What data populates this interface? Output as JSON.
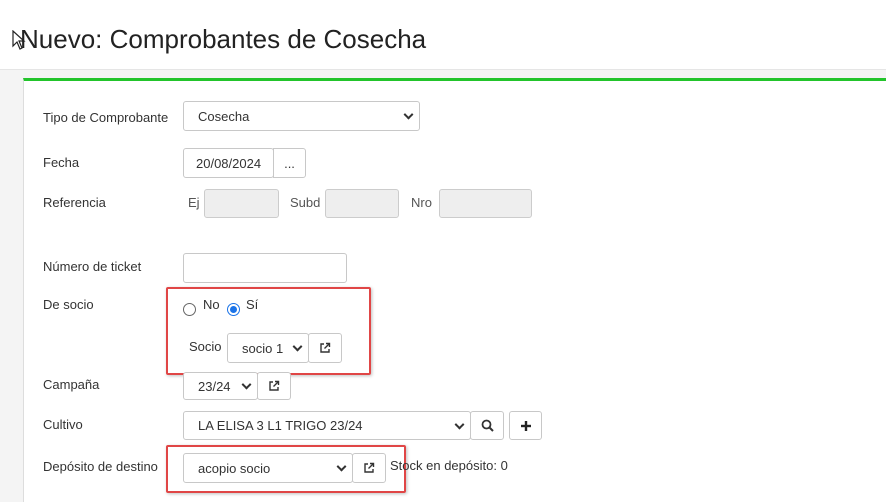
{
  "page": {
    "title": "Nuevo: Comprobantes de Cosecha"
  },
  "form": {
    "tipo_comprobante": {
      "label": "Tipo de Comprobante",
      "value": "Cosecha"
    },
    "fecha": {
      "label": "Fecha",
      "value": "20/08/2024",
      "picker_label": "..."
    },
    "referencia": {
      "label": "Referencia",
      "ej_label": "Ej",
      "subd_label": "Subd",
      "nro_label": "Nro"
    },
    "numero_ticket": {
      "label": "Número de ticket",
      "value": ""
    },
    "de_socio": {
      "label": "De socio",
      "option_no": "No",
      "option_si": "Sí",
      "selected": "Sí"
    },
    "socio": {
      "label": "Socio",
      "value": "socio 1"
    },
    "campana": {
      "label": "Campaña",
      "value": "23/24"
    },
    "cultivo": {
      "label": "Cultivo",
      "value": "LA ELISA 3 L1 TRIGO 23/24"
    },
    "deposito": {
      "label": "Depósito de destino",
      "value": "acopio socio",
      "stock_text": "Stock en depósito: 0"
    }
  },
  "colors": {
    "accent_green": "#22c42b",
    "highlight_red": "#e04646",
    "radio_blue": "#1a73e8"
  },
  "icons": [
    "external-link-icon",
    "search-icon",
    "plus-icon",
    "chevron-down-icon",
    "cursor-icon"
  ]
}
